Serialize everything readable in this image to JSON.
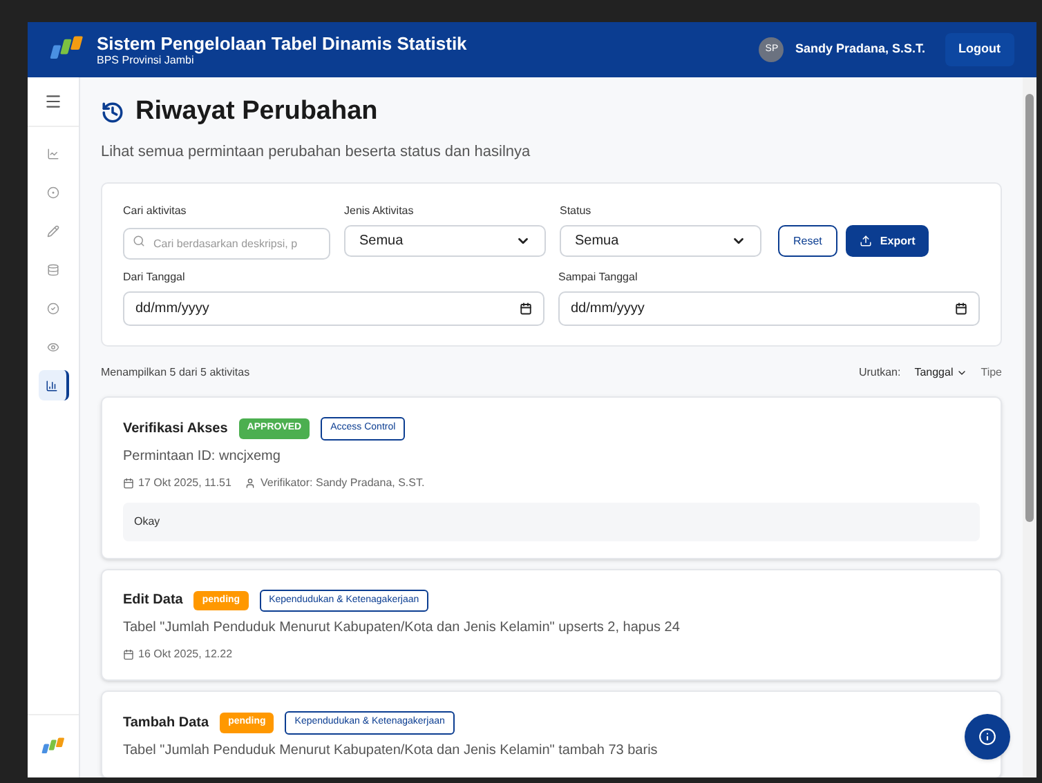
{
  "header": {
    "title": "Sistem Pengelolaan Tabel Dinamis Statistik",
    "subtitle": "BPS Provinsi Jambi",
    "avatar": "SP",
    "user": "Sandy Pradana, S.S.T.",
    "logout": "Logout"
  },
  "sidebar": {
    "items": [
      {
        "kind": "chart",
        "selected": false
      },
      {
        "kind": "target",
        "selected": false
      },
      {
        "kind": "pencil",
        "selected": false
      },
      {
        "kind": "database",
        "selected": false
      },
      {
        "kind": "check",
        "selected": false
      },
      {
        "kind": "eye",
        "selected": false
      },
      {
        "kind": "bars",
        "selected": true
      }
    ]
  },
  "page": {
    "title": "Riwayat Perubahan",
    "subtitle": "Lihat semua permintaan perubahan beserta status dan hasilnya"
  },
  "filters": {
    "search": {
      "label": "Cari aktivitas",
      "placeholder": "Cari berdasarkan deskripsi, p"
    },
    "type": {
      "label": "Jenis Aktivitas",
      "value": "Semua"
    },
    "status": {
      "label": "Status",
      "value": "Semua"
    },
    "reset": "Reset",
    "export": "Export",
    "from": {
      "label": "Dari Tanggal",
      "value": "dd/mm/yyyy"
    },
    "to": {
      "label": "Sampai Tanggal",
      "value": "dd/mm/yyyy"
    }
  },
  "summary": "Menampilkan 5 dari 5 aktivitas",
  "sort": {
    "label": "Urutkan:",
    "options": [
      {
        "label": "Tanggal",
        "selected": true
      },
      {
        "label": "Tipe",
        "selected": false
      }
    ]
  },
  "activities": [
    {
      "title": "Verifikasi Akses",
      "status": {
        "kind": "approved",
        "label": "APPROVED"
      },
      "tag": "Access Control",
      "description": "Permintaan ID: wncjxemg",
      "date": "17 Okt 2025, 11.51",
      "verifier": "Verifikator: Sandy Pradana, S.ST.",
      "note": "Okay"
    },
    {
      "title": "Edit Data",
      "status": {
        "kind": "pending",
        "label": "pending"
      },
      "tag": "Kependudukan & Ketenagakerjaan",
      "description": "Tabel \"Jumlah Penduduk Menurut Kabupaten/Kota dan Jenis Kelamin\" upserts 2, hapus 24",
      "date": "16 Okt 2025, 12.22"
    },
    {
      "title": "Tambah Data",
      "status": {
        "kind": "pending",
        "label": "pending"
      },
      "tag": "Kependudukan & Ketenagakerjaan",
      "description": "Tabel \"Jumlah Penduduk Menurut Kabupaten/Kota dan Jenis Kelamin\" tambah 73 baris"
    }
  ]
}
